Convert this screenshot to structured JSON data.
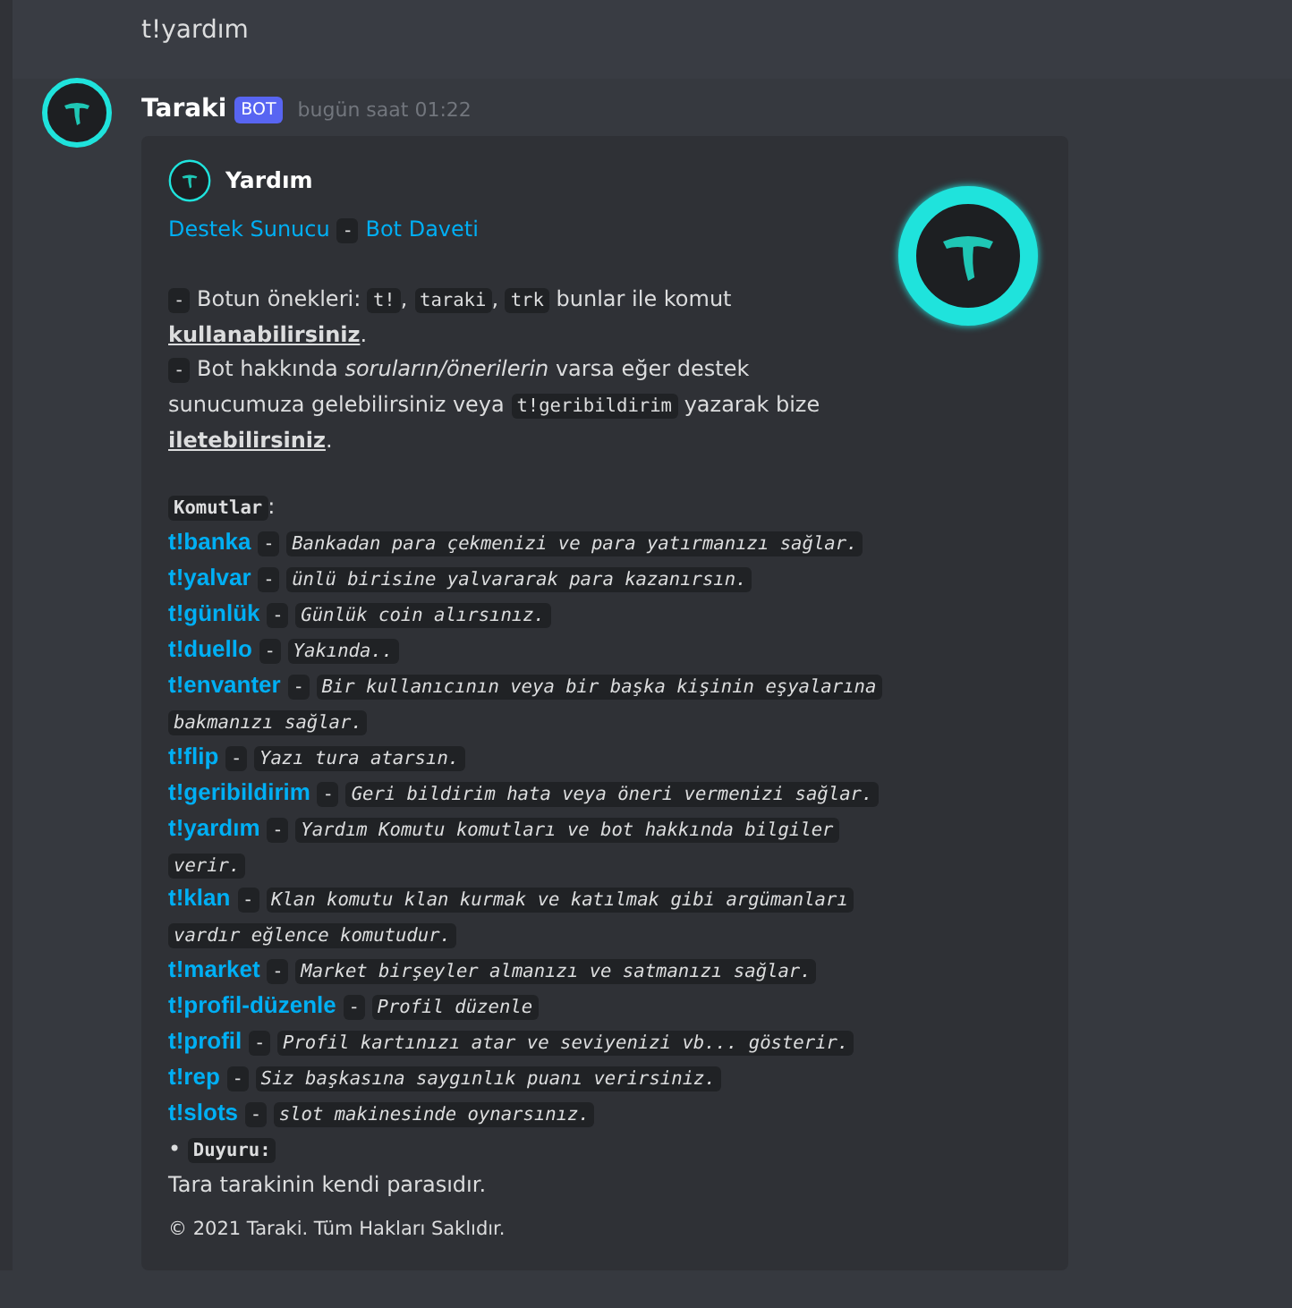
{
  "previous_message": {
    "text": "t!yardım"
  },
  "message": {
    "author": "Taraki",
    "badge": "BOT",
    "timestamp": "bugün saat 01:22"
  },
  "embed": {
    "title": "Yardım",
    "links": [
      {
        "kind": "link",
        "text": "Destek Sunucu"
      },
      {
        "kind": "code",
        "text": "-"
      },
      {
        "kind": "link",
        "text": "Bot Daveti"
      }
    ],
    "description": [
      [
        {
          "kind": "code",
          "text": "-"
        },
        {
          "kind": "text",
          "text": " Botun önekleri: "
        },
        {
          "kind": "code",
          "text": "t!"
        },
        {
          "kind": "text",
          "text": ", "
        },
        {
          "kind": "code",
          "text": "taraki"
        },
        {
          "kind": "text",
          "text": ", "
        },
        {
          "kind": "code",
          "text": "trk"
        },
        {
          "kind": "text",
          "text": " bunlar ile komut "
        },
        {
          "kind": "strong",
          "text": "kullanabilirsiniz"
        },
        {
          "kind": "text",
          "text": "."
        }
      ],
      [
        {
          "kind": "code",
          "text": "-"
        },
        {
          "kind": "text",
          "text": " Bot hakkında "
        },
        {
          "kind": "em",
          "text": "soruların/önerilerin"
        },
        {
          "kind": "text",
          "text": " varsa eğer destek sunucumuza gelebilirsiniz veya "
        },
        {
          "kind": "code",
          "text": "t!geribildirim"
        },
        {
          "kind": "text",
          "text": " yazarak bize "
        },
        {
          "kind": "strong",
          "text": "iletebilirsiniz"
        },
        {
          "kind": "text",
          "text": "."
        }
      ]
    ],
    "commands_heading": [
      {
        "kind": "code_bold",
        "text": "Komutlar"
      },
      {
        "kind": "text",
        "text": ":"
      }
    ],
    "commands": [
      {
        "name": "t!banka",
        "separator": "-",
        "description": "Bankadan para çekmenizi ve para yatırmanızı sağlar."
      },
      {
        "name": "t!yalvar",
        "separator": "-",
        "description": "ünlü birisine yalvararak para kazanırsın."
      },
      {
        "name": "t!günlük",
        "separator": "-",
        "description": "Günlük coin alırsınız."
      },
      {
        "name": "t!duello",
        "separator": "-",
        "description": "Yakında.."
      },
      {
        "name": "t!envanter",
        "separator": "-",
        "description": "Bir kullanıcının veya bir başka kişinin eşyalarına bakmanızı sağlar."
      },
      {
        "name": "t!flip",
        "separator": "-",
        "description": "Yazı tura atarsın."
      },
      {
        "name": "t!geribildirim",
        "separator": "-",
        "description": "Geri bildirim hata veya öneri vermenizi sağlar."
      },
      {
        "name": "t!yardım",
        "separator": "-",
        "description": "Yardım Komutu komutları ve bot hakkında bilgiler verir."
      },
      {
        "name": "t!klan",
        "separator": "-",
        "description": "Klan komutu klan kurmak ve katılmak gibi argümanları vardır eğlence komutudur."
      },
      {
        "name": "t!market",
        "separator": "-",
        "description": "Market birşeyler almanızı ve satmanızı sağlar."
      },
      {
        "name": "t!profil-düzenle",
        "separator": "-",
        "description": "Profil düzenle"
      },
      {
        "name": "t!profil",
        "separator": "-",
        "description": "Profil kartınızı atar ve seviyenizi vb... gösterir."
      },
      {
        "name": "t!rep",
        "separator": "-",
        "description": "Siz başkasına saygınlık puanı verirsiniz."
      },
      {
        "name": "t!slots",
        "separator": "-",
        "description": "slot makinesinde oynarsınız."
      }
    ],
    "announcement_heading": [
      {
        "kind": "text",
        "text": "• "
      },
      {
        "kind": "code_bold",
        "text": "Duyuru:"
      }
    ],
    "announcement": "Tara tarakinin kendi parasıdır.",
    "footer": "© 2021 Taraki. Tüm Hakları Saklıdır."
  }
}
